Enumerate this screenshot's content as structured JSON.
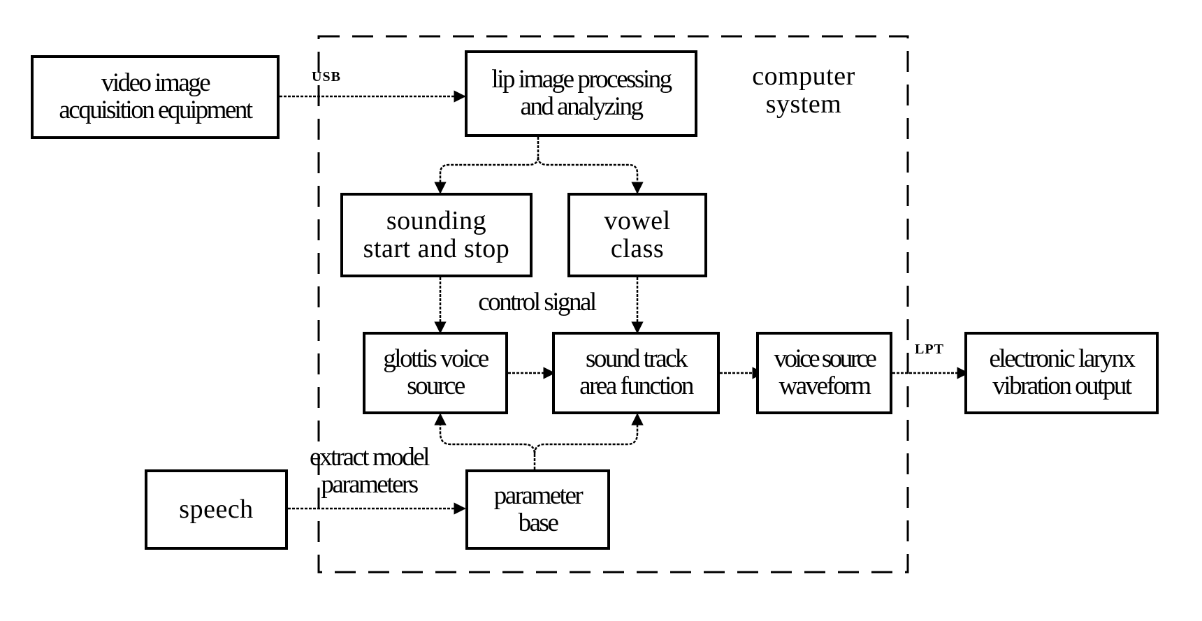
{
  "diagram": {
    "container": {
      "name": "computer system",
      "label_lines": [
        "computer",
        "system"
      ],
      "border_style": "dashed"
    },
    "nodes": [
      {
        "id": "video",
        "lines": [
          "video image",
          "acquisition equipment"
        ],
        "inside_container": false
      },
      {
        "id": "lip",
        "lines": [
          "lip image processing",
          "and analyzing"
        ],
        "inside_container": true
      },
      {
        "id": "sounding",
        "lines": [
          "sounding",
          "start and stop"
        ],
        "inside_container": true
      },
      {
        "id": "vowel",
        "lines": [
          "vowel",
          "class"
        ],
        "inside_container": true
      },
      {
        "id": "glottis",
        "lines": [
          "glottis voice",
          "source"
        ],
        "inside_container": true
      },
      {
        "id": "track",
        "lines": [
          "sound track",
          "area function"
        ],
        "inside_container": true
      },
      {
        "id": "waveform",
        "lines": [
          "voice source",
          "waveform"
        ],
        "inside_container": true
      },
      {
        "id": "larynx",
        "lines": [
          "electronic larynx",
          "vibration output"
        ],
        "inside_container": false
      },
      {
        "id": "speech",
        "lines": [
          "speech"
        ],
        "inside_container": false
      },
      {
        "id": "param",
        "lines": [
          "parameter",
          "base"
        ],
        "inside_container": true
      }
    ],
    "edge_labels": {
      "usb": "USB",
      "lpt": "LPT",
      "control": "control signal",
      "extract_lines": [
        "extract model",
        "parameters"
      ]
    },
    "edges": [
      {
        "from": "video",
        "to": "lip",
        "label": "USB"
      },
      {
        "from": "lip",
        "to": "sounding"
      },
      {
        "from": "lip",
        "to": "vowel"
      },
      {
        "from": "sounding",
        "to": "glottis",
        "label": "control signal"
      },
      {
        "from": "vowel",
        "to": "track",
        "label": "control signal"
      },
      {
        "from": "glottis",
        "to": "track"
      },
      {
        "from": "track",
        "to": "waveform"
      },
      {
        "from": "waveform",
        "to": "larynx",
        "label": "LPT"
      },
      {
        "from": "speech",
        "to": "param",
        "label": "extract model parameters"
      },
      {
        "from": "param",
        "to": "glottis"
      },
      {
        "from": "param",
        "to": "track"
      }
    ]
  }
}
